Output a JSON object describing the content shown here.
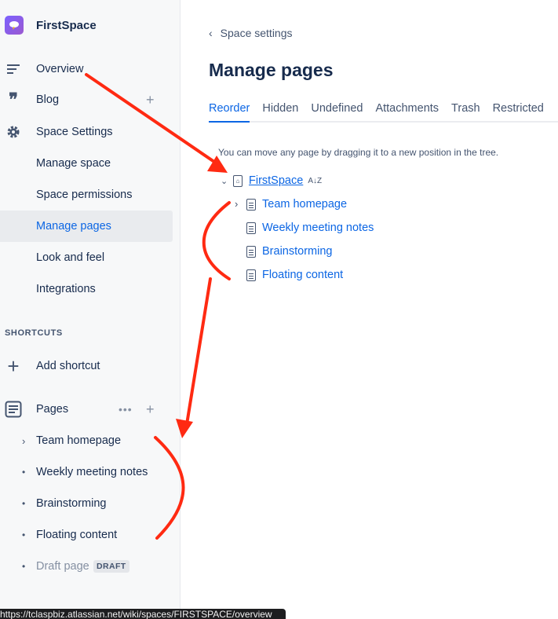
{
  "space": {
    "name": "FirstSpace"
  },
  "sidebar": {
    "overview": "Overview",
    "blog": "Blog",
    "space_settings": "Space Settings",
    "settings_items": [
      {
        "label": "Manage space"
      },
      {
        "label": "Space permissions"
      },
      {
        "label": "Manage pages",
        "selected": true
      },
      {
        "label": "Look and feel"
      },
      {
        "label": "Integrations"
      }
    ],
    "shortcuts_heading": "SHORTCUTS",
    "add_shortcut": "Add shortcut",
    "pages": "Pages",
    "page_tree": [
      {
        "label": "Team homepage",
        "expandable": true
      },
      {
        "label": "Weekly meeting notes"
      },
      {
        "label": "Brainstorming"
      },
      {
        "label": "Floating content"
      }
    ],
    "draft": {
      "label": "Draft page",
      "badge": "DRAFT"
    }
  },
  "main": {
    "back_label": "Space settings",
    "title": "Manage pages",
    "tabs": [
      {
        "label": "Reorder",
        "active": true
      },
      {
        "label": "Hidden"
      },
      {
        "label": "Undefined"
      },
      {
        "label": "Attachments"
      },
      {
        "label": "Trash"
      },
      {
        "label": "Restricted"
      }
    ],
    "hint": "You can move any page by dragging it to a new position in the tree.",
    "root": "FirstSpace",
    "sort_glyph": "A↓Z",
    "tree": [
      {
        "label": "Team homepage",
        "expandable": true
      },
      {
        "label": "Weekly meeting notes"
      },
      {
        "label": "Brainstorming"
      },
      {
        "label": "Floating content"
      }
    ]
  },
  "status_url": "https://tclaspbiz.atlassian.net/wiki/spaces/FIRSTSPACE/overview",
  "colors": {
    "link": "#0c66e4",
    "annotation": "#ff2a12",
    "logo": "#7b61ff"
  }
}
